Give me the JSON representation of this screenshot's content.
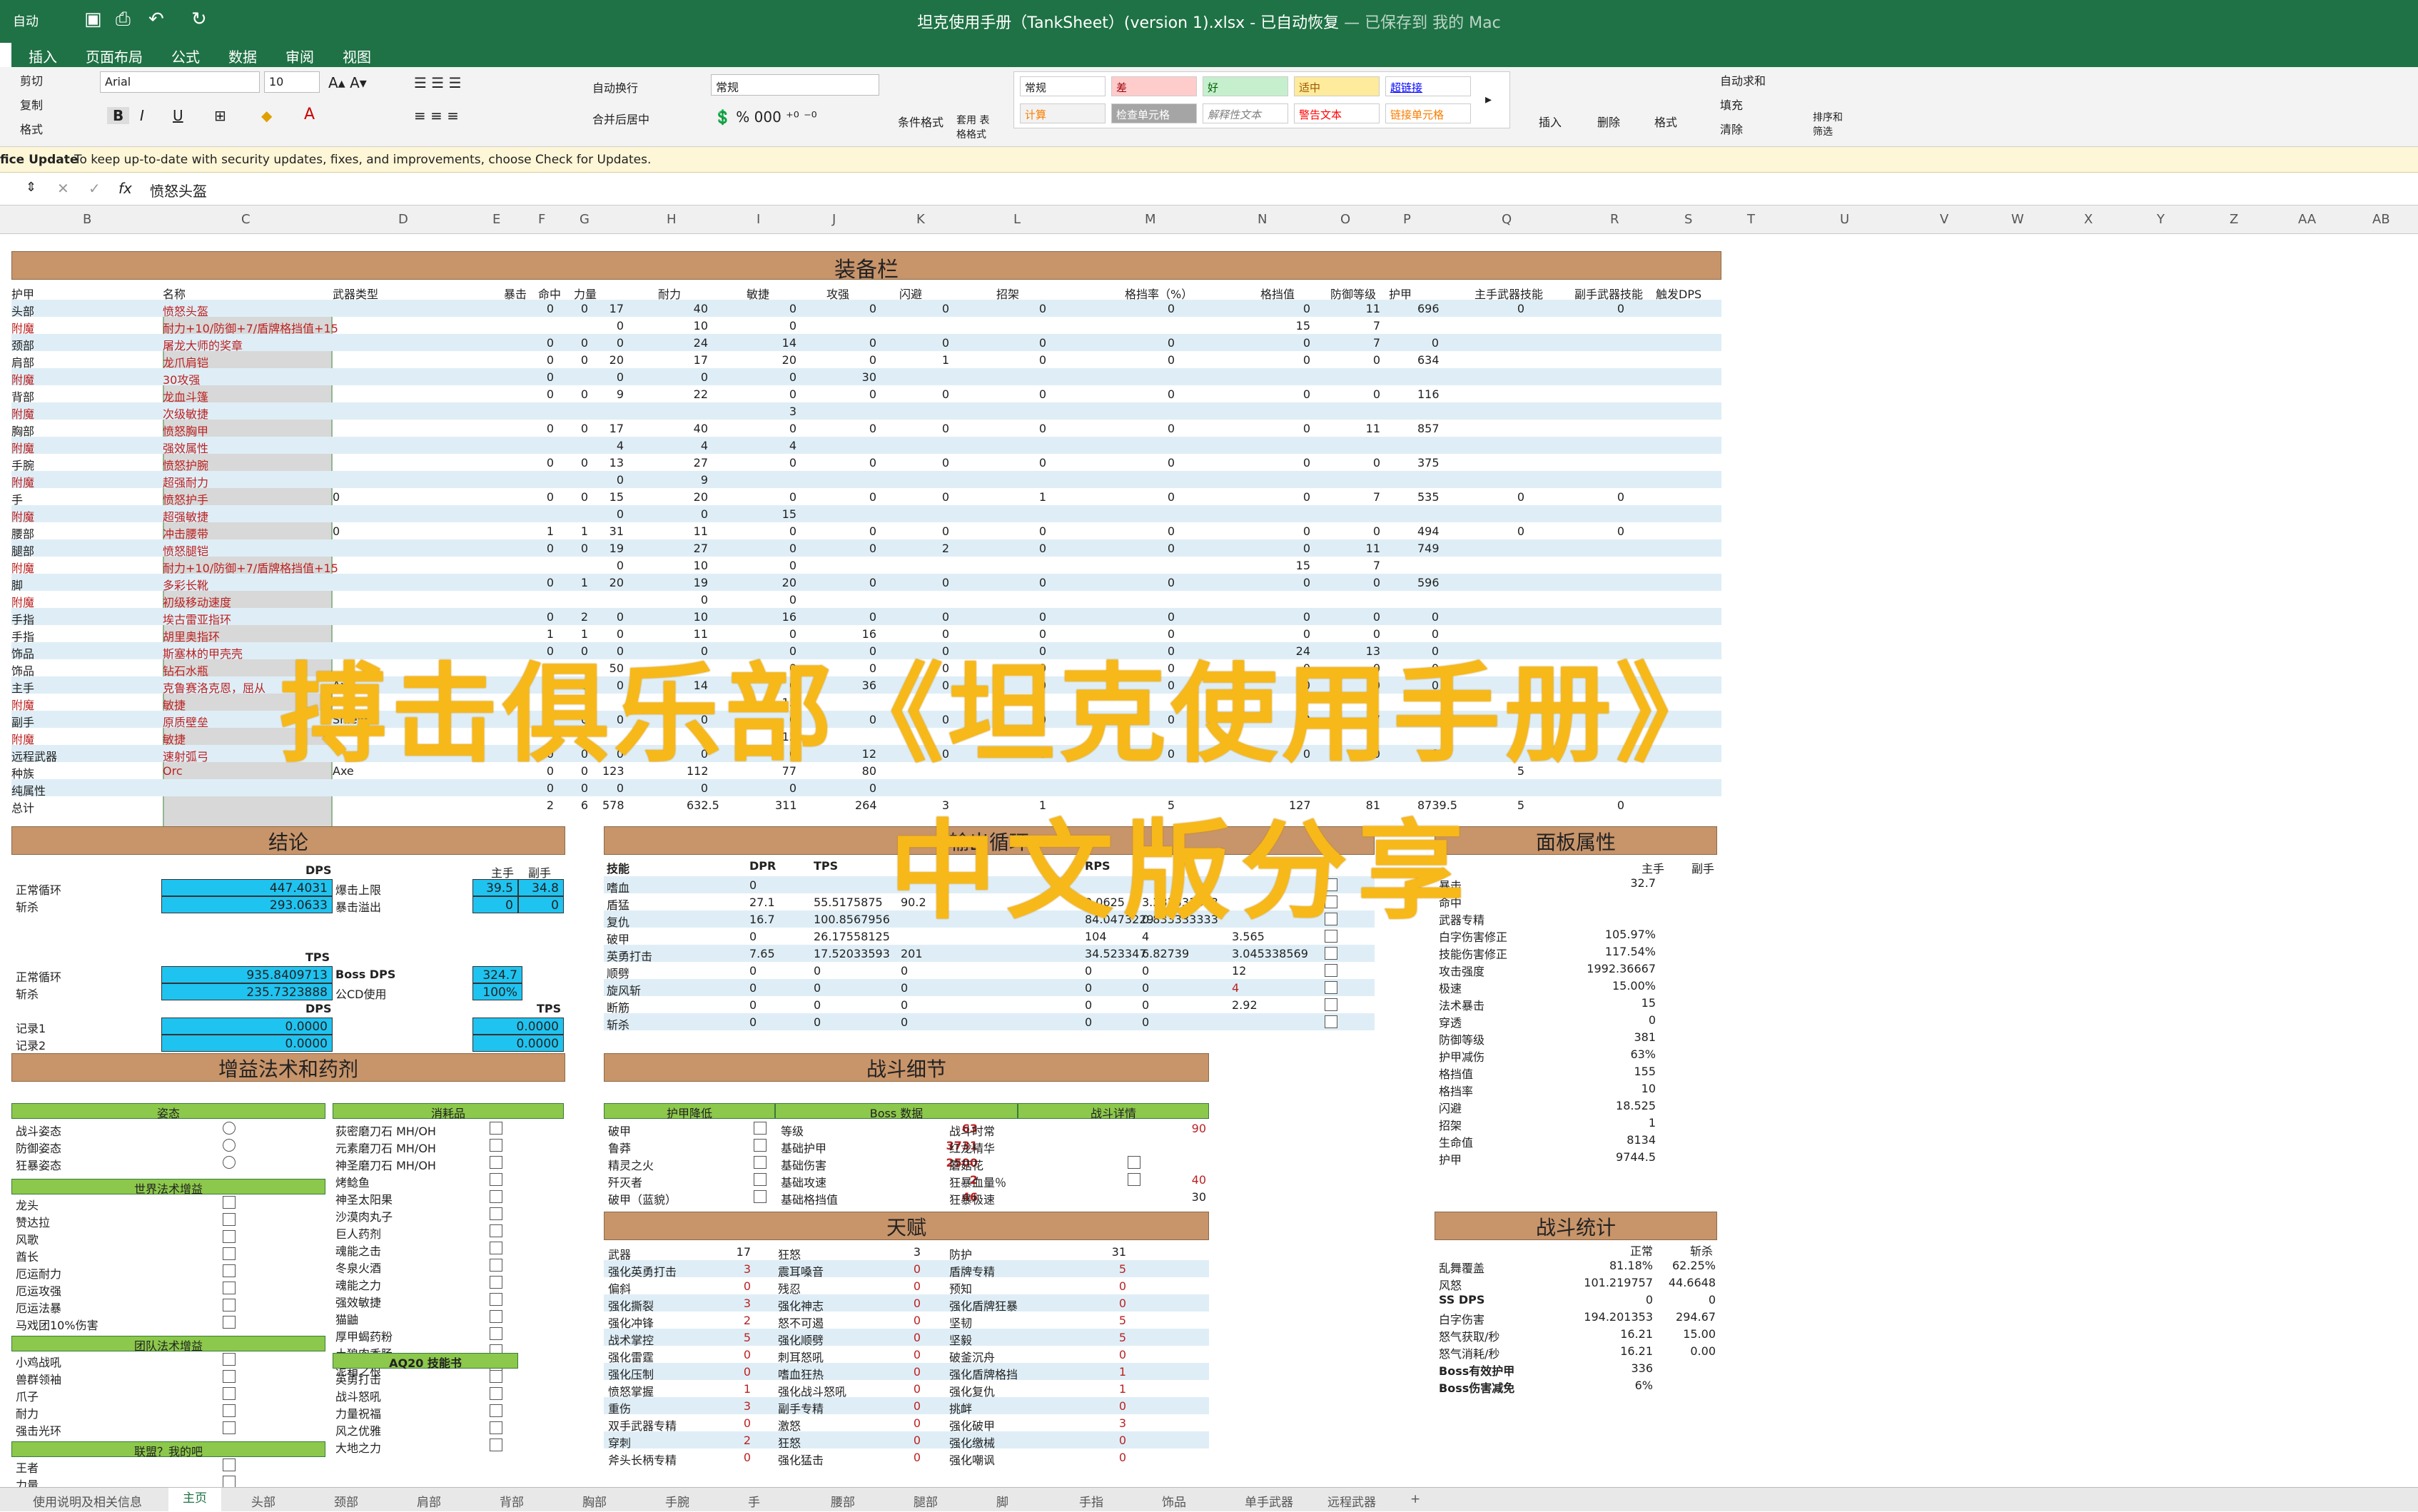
{
  "window": {
    "title": "坦克使用手册（TankSheet）(version 1).xlsx - 已自动恢复",
    "saved": "— 已保存到 我的 Mac",
    "autosave": "自动"
  },
  "menu": [
    "插入",
    "页面布局",
    "公式",
    "数据",
    "审阅",
    "视图"
  ],
  "ribbon": {
    "cut": "剪切",
    "copy": "复制",
    "format_painter": "格式",
    "font": "Arial",
    "size": "10",
    "wrap": "自动换行",
    "merge": "合并后居中",
    "numfmt": "常规",
    "cond": "条件格式",
    "table": "套用 表格格式",
    "styles": [
      "常规",
      "差",
      "好",
      "适中",
      "超链接",
      "计算",
      "检查单元格",
      "解释性文本",
      "警告文本",
      "链接单元格"
    ],
    "insert": "插入",
    "delete": "删除",
    "format": "格式",
    "autosum": "自动求和",
    "fill": "填充",
    "clear": "清除",
    "sort": "排序和 筛选"
  },
  "notice": {
    "label": "fice Update",
    "text": "To keep up-to-date with security updates, fixes, and improvements, choose Check for Updates."
  },
  "formula": {
    "fx": "fx",
    "value": "愤怒头盔"
  },
  "columns": [
    "B",
    "C",
    "D",
    "E",
    "F",
    "G",
    "H",
    "I",
    "J",
    "K",
    "L",
    "M",
    "N",
    "O",
    "P",
    "Q",
    "R",
    "S",
    "T",
    "U",
    "V",
    "W",
    "X",
    "Y",
    "Z",
    "AA",
    "AB"
  ],
  "equip": {
    "title": "装备栏",
    "headers": [
      "护甲",
      "名称",
      "武器类型",
      "暴击",
      "命中",
      "力量",
      "耐力",
      "敏捷",
      "攻强",
      "闪避",
      "招架",
      "格挡率（%）",
      "格挡值",
      "防御等级",
      "护甲",
      "主手武器技能",
      "副手武器技能",
      "触发DPS"
    ],
    "rows": [
      [
        "头部",
        "愤怒头盔",
        "",
        "0",
        "0",
        "17",
        "40",
        "0",
        "0",
        "0",
        "0",
        "0",
        "0",
        "11",
        "696",
        "0",
        "0"
      ],
      [
        "附魔",
        "耐力+10/防御+7/盾牌格挡值+15",
        "",
        "",
        "",
        "0",
        "10",
        "0",
        "",
        "",
        "",
        "",
        "15",
        "7",
        "",
        "",
        ""
      ],
      [
        "颈部",
        "屠龙大师的奖章",
        "",
        "0",
        "0",
        "0",
        "24",
        "14",
        "0",
        "0",
        "0",
        "0",
        "0",
        "7",
        "0",
        "",
        ""
      ],
      [
        "肩部",
        "龙爪肩铠",
        "",
        "0",
        "0",
        "20",
        "17",
        "20",
        "0",
        "1",
        "0",
        "0",
        "0",
        "0",
        "634",
        "",
        ""
      ],
      [
        "附魔",
        "30攻强",
        "",
        "0",
        "",
        "0",
        "0",
        "0",
        "30",
        "",
        "",
        "",
        "",
        "",
        "",
        "",
        ""
      ],
      [
        "背部",
        "龙血斗篷",
        "",
        "0",
        "0",
        "9",
        "22",
        "0",
        "0",
        "0",
        "0",
        "0",
        "0",
        "0",
        "116",
        "",
        ""
      ],
      [
        "附魔",
        "次级敏捷",
        "",
        "",
        "",
        "",
        "",
        "3",
        "",
        "",
        "",
        "",
        "",
        "",
        "",
        "",
        ""
      ],
      [
        "胸部",
        "愤怒胸甲",
        "",
        "0",
        "0",
        "17",
        "40",
        "0",
        "0",
        "0",
        "0",
        "0",
        "0",
        "11",
        "857",
        "",
        ""
      ],
      [
        "附魔",
        "强效属性",
        "",
        "",
        "",
        "4",
        "4",
        "4",
        "",
        "",
        "",
        "",
        "",
        "",
        "",
        "",
        ""
      ],
      [
        "手腕",
        "愤怒护腕",
        "",
        "0",
        "0",
        "13",
        "27",
        "0",
        "0",
        "0",
        "0",
        "0",
        "0",
        "0",
        "375",
        "",
        ""
      ],
      [
        "附魔",
        "超强耐力",
        "",
        "",
        "",
        "0",
        "9",
        "",
        "",
        "",
        "",
        "",
        "",
        "",
        "",
        "",
        ""
      ],
      [
        "手",
        "愤怒护手",
        "0",
        "0",
        "0",
        "15",
        "20",
        "0",
        "0",
        "0",
        "1",
        "0",
        "0",
        "7",
        "535",
        "0",
        "0"
      ],
      [
        "附魔",
        "超强敏捷",
        "",
        "",
        "",
        "0",
        "0",
        "15",
        "",
        "",
        "",
        "",
        "",
        "",
        "",
        "",
        ""
      ],
      [
        "腰部",
        "冲击腰带",
        "0",
        "1",
        "1",
        "31",
        "11",
        "0",
        "0",
        "0",
        "0",
        "0",
        "0",
        "0",
        "494",
        "0",
        "0"
      ],
      [
        "腿部",
        "愤怒腿铠",
        "",
        "0",
        "0",
        "19",
        "27",
        "0",
        "0",
        "2",
        "0",
        "0",
        "0",
        "11",
        "749",
        "",
        ""
      ],
      [
        "附魔",
        "耐力+10/防御+7/盾牌格挡值+15",
        "",
        "",
        "",
        "0",
        "10",
        "0",
        "",
        "",
        "",
        "",
        "15",
        "7",
        "",
        "",
        ""
      ],
      [
        "脚",
        "多彩长靴",
        "",
        "0",
        "1",
        "20",
        "19",
        "20",
        "0",
        "0",
        "0",
        "0",
        "0",
        "0",
        "596",
        "",
        ""
      ],
      [
        "附魔",
        "初级移动速度",
        "",
        "",
        "",
        "",
        "0",
        "0",
        "",
        "",
        "",
        "",
        "",
        "",
        "",
        "",
        ""
      ],
      [
        "手指",
        "埃古雷亚指环",
        "",
        "0",
        "2",
        "0",
        "10",
        "16",
        "0",
        "0",
        "0",
        "0",
        "0",
        "0",
        "0",
        "",
        ""
      ],
      [
        "手指",
        "胡里奥指环",
        "",
        "1",
        "1",
        "0",
        "11",
        "0",
        "16",
        "0",
        "0",
        "0",
        "0",
        "0",
        "0",
        "",
        ""
      ],
      [
        "饰品",
        "斯塞林的甲壳壳",
        "",
        "0",
        "0",
        "0",
        "0",
        "0",
        "0",
        "0",
        "0",
        "0",
        "24",
        "13",
        "0",
        "",
        ""
      ],
      [
        "饰品",
        "钻石水瓶",
        "",
        "0",
        "0",
        "50",
        "0",
        "0",
        "0",
        "0",
        "0",
        "0",
        "0",
        "0",
        "0",
        "",
        ""
      ],
      [
        "主手",
        "克鲁赛洛克恩，屈从",
        "Axe",
        "0",
        "0",
        "0",
        "14",
        "0",
        "36",
        "0",
        "0",
        "0",
        "0",
        "0",
        "0",
        "",
        ""
      ],
      [
        "附魔",
        "敏捷",
        "",
        "",
        "",
        "",
        "",
        "15",
        "",
        "",
        "",
        "",
        "",
        "",
        "",
        "",
        ""
      ],
      [
        "副手",
        "原质壁垒",
        "Shield",
        "0",
        "0",
        "0",
        "0",
        "0",
        "0",
        "0",
        "0",
        "0",
        "3",
        "7",
        "2893",
        "",
        ""
      ],
      [
        "附魔",
        "敏捷",
        "",
        "",
        "",
        "",
        "",
        "15",
        "",
        "",
        "",
        "",
        "",
        "",
        "",
        "",
        ""
      ],
      [
        "远程武器",
        "速射弧弓",
        "",
        "0",
        "0",
        "0",
        "0",
        "0",
        "12",
        "0",
        "0",
        "0",
        "0",
        "0",
        "0",
        "",
        ""
      ],
      [
        "种族",
        "Orc",
        "Axe",
        "0",
        "0",
        "123",
        "112",
        "77",
        "80",
        "",
        "",
        "",
        "",
        "",
        "",
        "5",
        ""
      ],
      [
        "纯属性",
        "",
        "",
        "0",
        "0",
        "0",
        "0",
        "0",
        "0",
        "",
        "",
        "",
        "",
        "",
        "",
        "",
        ""
      ],
      [
        "总计",
        "",
        "",
        "2",
        "6",
        "578",
        "632.5",
        "311",
        "264",
        "3",
        "1",
        "5",
        "127",
        "81",
        "8739.5",
        "5",
        "0"
      ]
    ]
  },
  "conclusion": {
    "title": "结论",
    "dps": "DPS",
    "main": "主手",
    "off": "副手",
    "normal": "正常循环",
    "execute": "斩杀",
    "dps_normal": "447.4031",
    "dps_exec": "293.0633",
    "crit_cap": "爆击上限",
    "crit_over": "暴击溢出",
    "cap_main": "39.5",
    "cap_off": "34.8",
    "over_main": "0",
    "over_off": "0",
    "tps": "TPS",
    "tps_normal": "935.8409713",
    "tps_exec": "235.7323888",
    "boss_dps": "Boss DPS",
    "boss_val": "324.7",
    "cd": "公CD使用",
    "cd_val": "100%",
    "rec1": "记录1",
    "rec2": "记录2",
    "rec_dps1": "0.0000",
    "rec_dps2": "0.0000",
    "rec_tps1": "0.0000",
    "rec_tps2": "0.0000"
  },
  "rotation": {
    "title": "输出循环",
    "headers": [
      "技能",
      "DPR",
      "TPS",
      "",
      "RPS",
      ""
    ],
    "rows": [
      [
        "嗜血",
        "0",
        "",
        "",
        "",
        ""
      ],
      [
        "盾猛",
        "27.1",
        "55.5175875",
        "90.2",
        "0.0625",
        "3.333333333"
      ],
      [
        "复仇",
        "16.7",
        "100.8567956",
        "",
        "84.0473229",
        "0.833333333"
      ],
      [
        "破甲",
        "0",
        "26.17558125",
        "",
        "104",
        "4"
      ],
      [
        "英勇打击",
        "7.65",
        "17.52033593",
        "201",
        "34.523347",
        "6.82739"
      ],
      [
        "顺劈",
        "0",
        "0",
        "0",
        "0",
        "0"
      ],
      [
        "旋风斩",
        "0",
        "0",
        "0",
        "0",
        "0"
      ],
      [
        "断筋",
        "0",
        "0",
        "0",
        "0",
        "0"
      ],
      [
        "斩杀",
        "0",
        "0",
        "0",
        "0",
        "0"
      ]
    ],
    "extra": [
      "3.565",
      "3.045338569",
      "12",
      "4",
      "2.92"
    ]
  },
  "panel": {
    "title": "面板属性",
    "headers": [
      "主手",
      "副手"
    ],
    "rows": [
      [
        "暴击",
        "32.7"
      ],
      [
        "命中",
        ""
      ],
      [
        "武器专精",
        ""
      ],
      [
        "白字伤害修正",
        "105.97%"
      ],
      [
        "技能伤害修正",
        "117.54%"
      ],
      [
        "攻击强度",
        "1992.36667"
      ],
      [
        "极速",
        "15.00%"
      ],
      [
        "法术暴击",
        "15"
      ],
      [
        "穿透",
        "0"
      ],
      [
        "防御等级",
        "381"
      ],
      [
        "护甲减伤",
        "63%"
      ],
      [
        "格挡值",
        "155"
      ],
      [
        "格挡率",
        "10"
      ],
      [
        "闪避",
        "18.525"
      ],
      [
        "招架",
        "1"
      ],
      [
        "生命值",
        "8134"
      ],
      [
        "护甲",
        "9744.5"
      ]
    ]
  },
  "buffs": {
    "title": "增益法术和药剂",
    "stance": "姿态",
    "consumables": "消耗品",
    "stances": [
      "战斗姿态",
      "防御姿态",
      "狂暴姿态"
    ],
    "cons": [
      "荻密磨刀石 MH/OH",
      "元素磨刀石 MH/OH",
      "神圣磨刀石 MH/OH",
      "烤鲶鱼",
      "神圣太阳果",
      "沙漠肉丸子",
      "巨人药剂",
      "魂能之击",
      "冬泉火酒",
      "魂能之力",
      "强效敏捷",
      "猫鼬",
      "厚甲蝎药粉",
      "土狼肉香肠",
      "泥箱之根"
    ],
    "world": "世界法术增益",
    "worldlist": [
      "龙头",
      "赞达拉",
      "风歌",
      "酋长",
      "厄运耐力",
      "厄运攻强",
      "厄运法暴",
      "马戏团10%伤害"
    ],
    "team": "团队法术增益",
    "teamlist": [
      "小鸡战吼",
      "兽群领袖",
      "爪子",
      "耐力",
      "强击光环"
    ],
    "aq": "AQ20 技能书",
    "aqlist": [
      "英勇打击",
      "战斗怒吼",
      "力量祝福",
      "风之优雅",
      "大地之力"
    ],
    "ally": "联盟？我的吧",
    "allylist": [
      "王者",
      "力量"
    ]
  },
  "combat": {
    "title": "战斗细节",
    "armor": "护甲降低",
    "boss": "Boss 数据",
    "detail": "战斗详情",
    "left": [
      "破甲",
      "鲁莽",
      "精灵之火",
      "歼灭者",
      "破甲（蓝貌）"
    ],
    "bossrows": [
      [
        "等级",
        "63"
      ],
      [
        "基础护甲",
        "3731"
      ],
      [
        "基础伤害",
        "2500"
      ],
      [
        "基础攻速",
        "2"
      ],
      [
        "基础格挡值",
        "46"
      ]
    ],
    "det": [
      [
        "战斗时常",
        "90"
      ],
      [
        "红龙精华",
        ""
      ],
      [
        "蘑菇花",
        ""
      ],
      [
        "狂暴血量％",
        "40"
      ],
      [
        "狂暴极速",
        "30"
      ]
    ]
  },
  "talent": {
    "title": "天赋",
    "rows": [
      [
        "武器",
        "17",
        "狂怒",
        "3",
        "防护",
        "31"
      ],
      [
        "强化英勇打击",
        "3",
        "震耳嗓音",
        "0",
        "盾牌专精",
        "5"
      ],
      [
        "偏斜",
        "0",
        "残忍",
        "0",
        "预知",
        "0"
      ],
      [
        "强化撕裂",
        "3",
        "强化神志",
        "0",
        "强化盾牌狂暴",
        "0"
      ],
      [
        "强化冲锋",
        "2",
        "怒不可遏",
        "0",
        "坚韧",
        "5"
      ],
      [
        "战术掌控",
        "5",
        "强化顺劈",
        "0",
        "坚毅",
        "5"
      ],
      [
        "强化雷霆",
        "0",
        "刺耳怒吼",
        "0",
        "破釜沉舟",
        "0"
      ],
      [
        "强化压制",
        "0",
        "嗜血狂热",
        "0",
        "强化盾牌格挡",
        "1"
      ],
      [
        "愤怒掌握",
        "1",
        "强化战斗怒吼",
        "0",
        "强化复仇",
        "1"
      ],
      [
        "重伤",
        "3",
        "副手专精",
        "0",
        "挑衅",
        "0"
      ],
      [
        "双手武器专精",
        "0",
        "激怒",
        "0",
        "强化破甲",
        "3"
      ],
      [
        "穿刺",
        "2",
        "狂怒",
        "0",
        "强化缴械",
        "0"
      ],
      [
        "斧头长柄专精",
        "0",
        "强化猛击",
        "0",
        "强化嘲讽",
        "0"
      ]
    ]
  },
  "stats": {
    "title": "战斗统计",
    "headers": [
      "正常",
      "斩杀"
    ],
    "rows": [
      [
        "乱舞覆盖",
        "81.18%",
        "62.25%"
      ],
      [
        "风怒",
        "101.219757",
        "44.6648"
      ],
      [
        "SS DPS",
        "0",
        "0"
      ],
      [
        "白字伤害",
        "194.201353",
        "294.67"
      ],
      [
        "怒气获取/秒",
        "16.21",
        "15.00"
      ],
      [
        "怒气消耗/秒",
        "16.21",
        "0.00"
      ],
      [
        "Boss有效护甲",
        "336",
        ""
      ],
      [
        "Boss伤害减免",
        "6%",
        ""
      ]
    ]
  },
  "tabs": [
    "使用说明及相关信息",
    "主页",
    "头部",
    "颈部",
    "肩部",
    "背部",
    "胸部",
    "手腕",
    "手",
    "腰部",
    "腿部",
    "脚",
    "手指",
    "饰品",
    "单手武器",
    "远程武器",
    "+"
  ],
  "overlay": {
    "line1": "搏击俱乐部《坦克使用手册》",
    "line2": "中文版分享"
  }
}
